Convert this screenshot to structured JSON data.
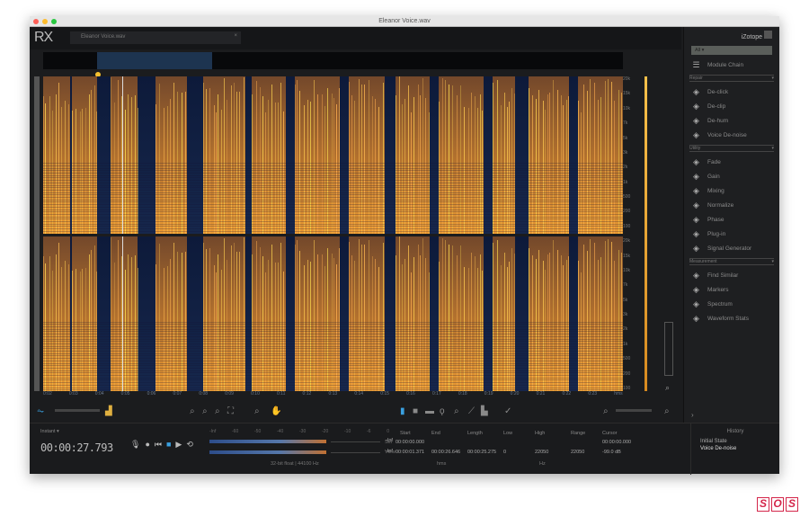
{
  "window": {
    "title": "Eleanor Voice.wav",
    "traffic_lights": [
      "#fc5f57",
      "#fdbc2e",
      "#28c840"
    ]
  },
  "app": {
    "logo": "RX",
    "tab_label": "Eleanor Voice.wav",
    "tab_close": "×"
  },
  "ruler": {
    "labels": [
      "0:02",
      "0:03",
      "0:04",
      "0:05",
      "0:06",
      "0:07",
      "0:08",
      "0:09",
      "0:10",
      "0:11",
      "0:12",
      "0:13",
      "0:14",
      "0:15",
      "0:16",
      "0:17",
      "0:18",
      "0:19",
      "0:20",
      "0:21",
      "0:22",
      "0:23",
      "hms"
    ]
  },
  "freq_scale": {
    "labels": [
      "20k",
      "15k",
      "10k",
      "7k",
      "5k",
      "3k",
      "2k",
      "1k",
      "500",
      "200",
      "100",
      "20k",
      "15k",
      "10k",
      "7k",
      "5k",
      "3k",
      "2k",
      "1k",
      "500",
      "200",
      "100"
    ]
  },
  "sidebar": {
    "brand": "iZotope",
    "preset_select": "All",
    "module_chain": "Module Chain",
    "sections": [
      {
        "label": "Repair",
        "items": [
          {
            "icon": "declick-icon",
            "label": "De-click"
          },
          {
            "icon": "dehum-icon",
            "label": "De-clip"
          },
          {
            "icon": "lightning-icon",
            "label": "De-hum"
          },
          {
            "icon": "voice-denoise-icon",
            "label": "Voice De-noise"
          }
        ]
      },
      {
        "label": "Utility",
        "items": [
          {
            "icon": "fade-icon",
            "label": "Fade"
          },
          {
            "icon": "gain-icon",
            "label": "Gain"
          },
          {
            "icon": "mixing-icon",
            "label": "Mixing"
          },
          {
            "icon": "normalize-icon",
            "label": "Normalize"
          },
          {
            "icon": "phase-icon",
            "label": "Phase"
          },
          {
            "icon": "plugin-icon",
            "label": "Plug-in"
          },
          {
            "icon": "signal-generator-icon",
            "label": "Signal Generator"
          }
        ]
      },
      {
        "label": "Measurement",
        "items": [
          {
            "icon": "find-similar-icon",
            "label": "Find Similar"
          },
          {
            "icon": "markers-icon",
            "label": "Markers"
          },
          {
            "icon": "spectrum-icon",
            "label": "Spectrum"
          },
          {
            "icon": "waveform-stats-icon",
            "label": "Waveform Stats"
          }
        ]
      }
    ]
  },
  "transport": {
    "format_label": "Instant ▾",
    "time": "00:00:27.793"
  },
  "meter": {
    "scale": [
      "-Inf",
      "-60",
      "-50",
      "-40",
      "-30",
      "-20",
      "-10",
      "-6",
      "0"
    ],
    "left_value": "-Inf",
    "right_value": "-Inf",
    "format": "32-bit float | 44100 Hz"
  },
  "selection": {
    "headers": [
      "Start",
      "End",
      "Length",
      "Low",
      "High",
      "Range",
      "Cursor"
    ],
    "rows": [
      {
        "label": "Sel",
        "values": [
          "00:00:00.000",
          "",
          "",
          "",
          "",
          "",
          "00:00:00.000"
        ]
      },
      {
        "label": "View",
        "values": [
          "00:00:01.371",
          "00:00:26.646",
          "00:00:25.275",
          "0",
          "22050",
          "22050",
          "-99.0 dB"
        ]
      }
    ],
    "units": [
      "hms",
      "Hz"
    ]
  },
  "history": {
    "title": "History",
    "items": [
      "Initial State",
      "Voice De-noise"
    ]
  },
  "watermark": "SOS",
  "colors": {
    "spectrogram_low": "#0d1a3a",
    "spectrogram_high": "#f0902a",
    "accent": "#3aa0e0"
  }
}
